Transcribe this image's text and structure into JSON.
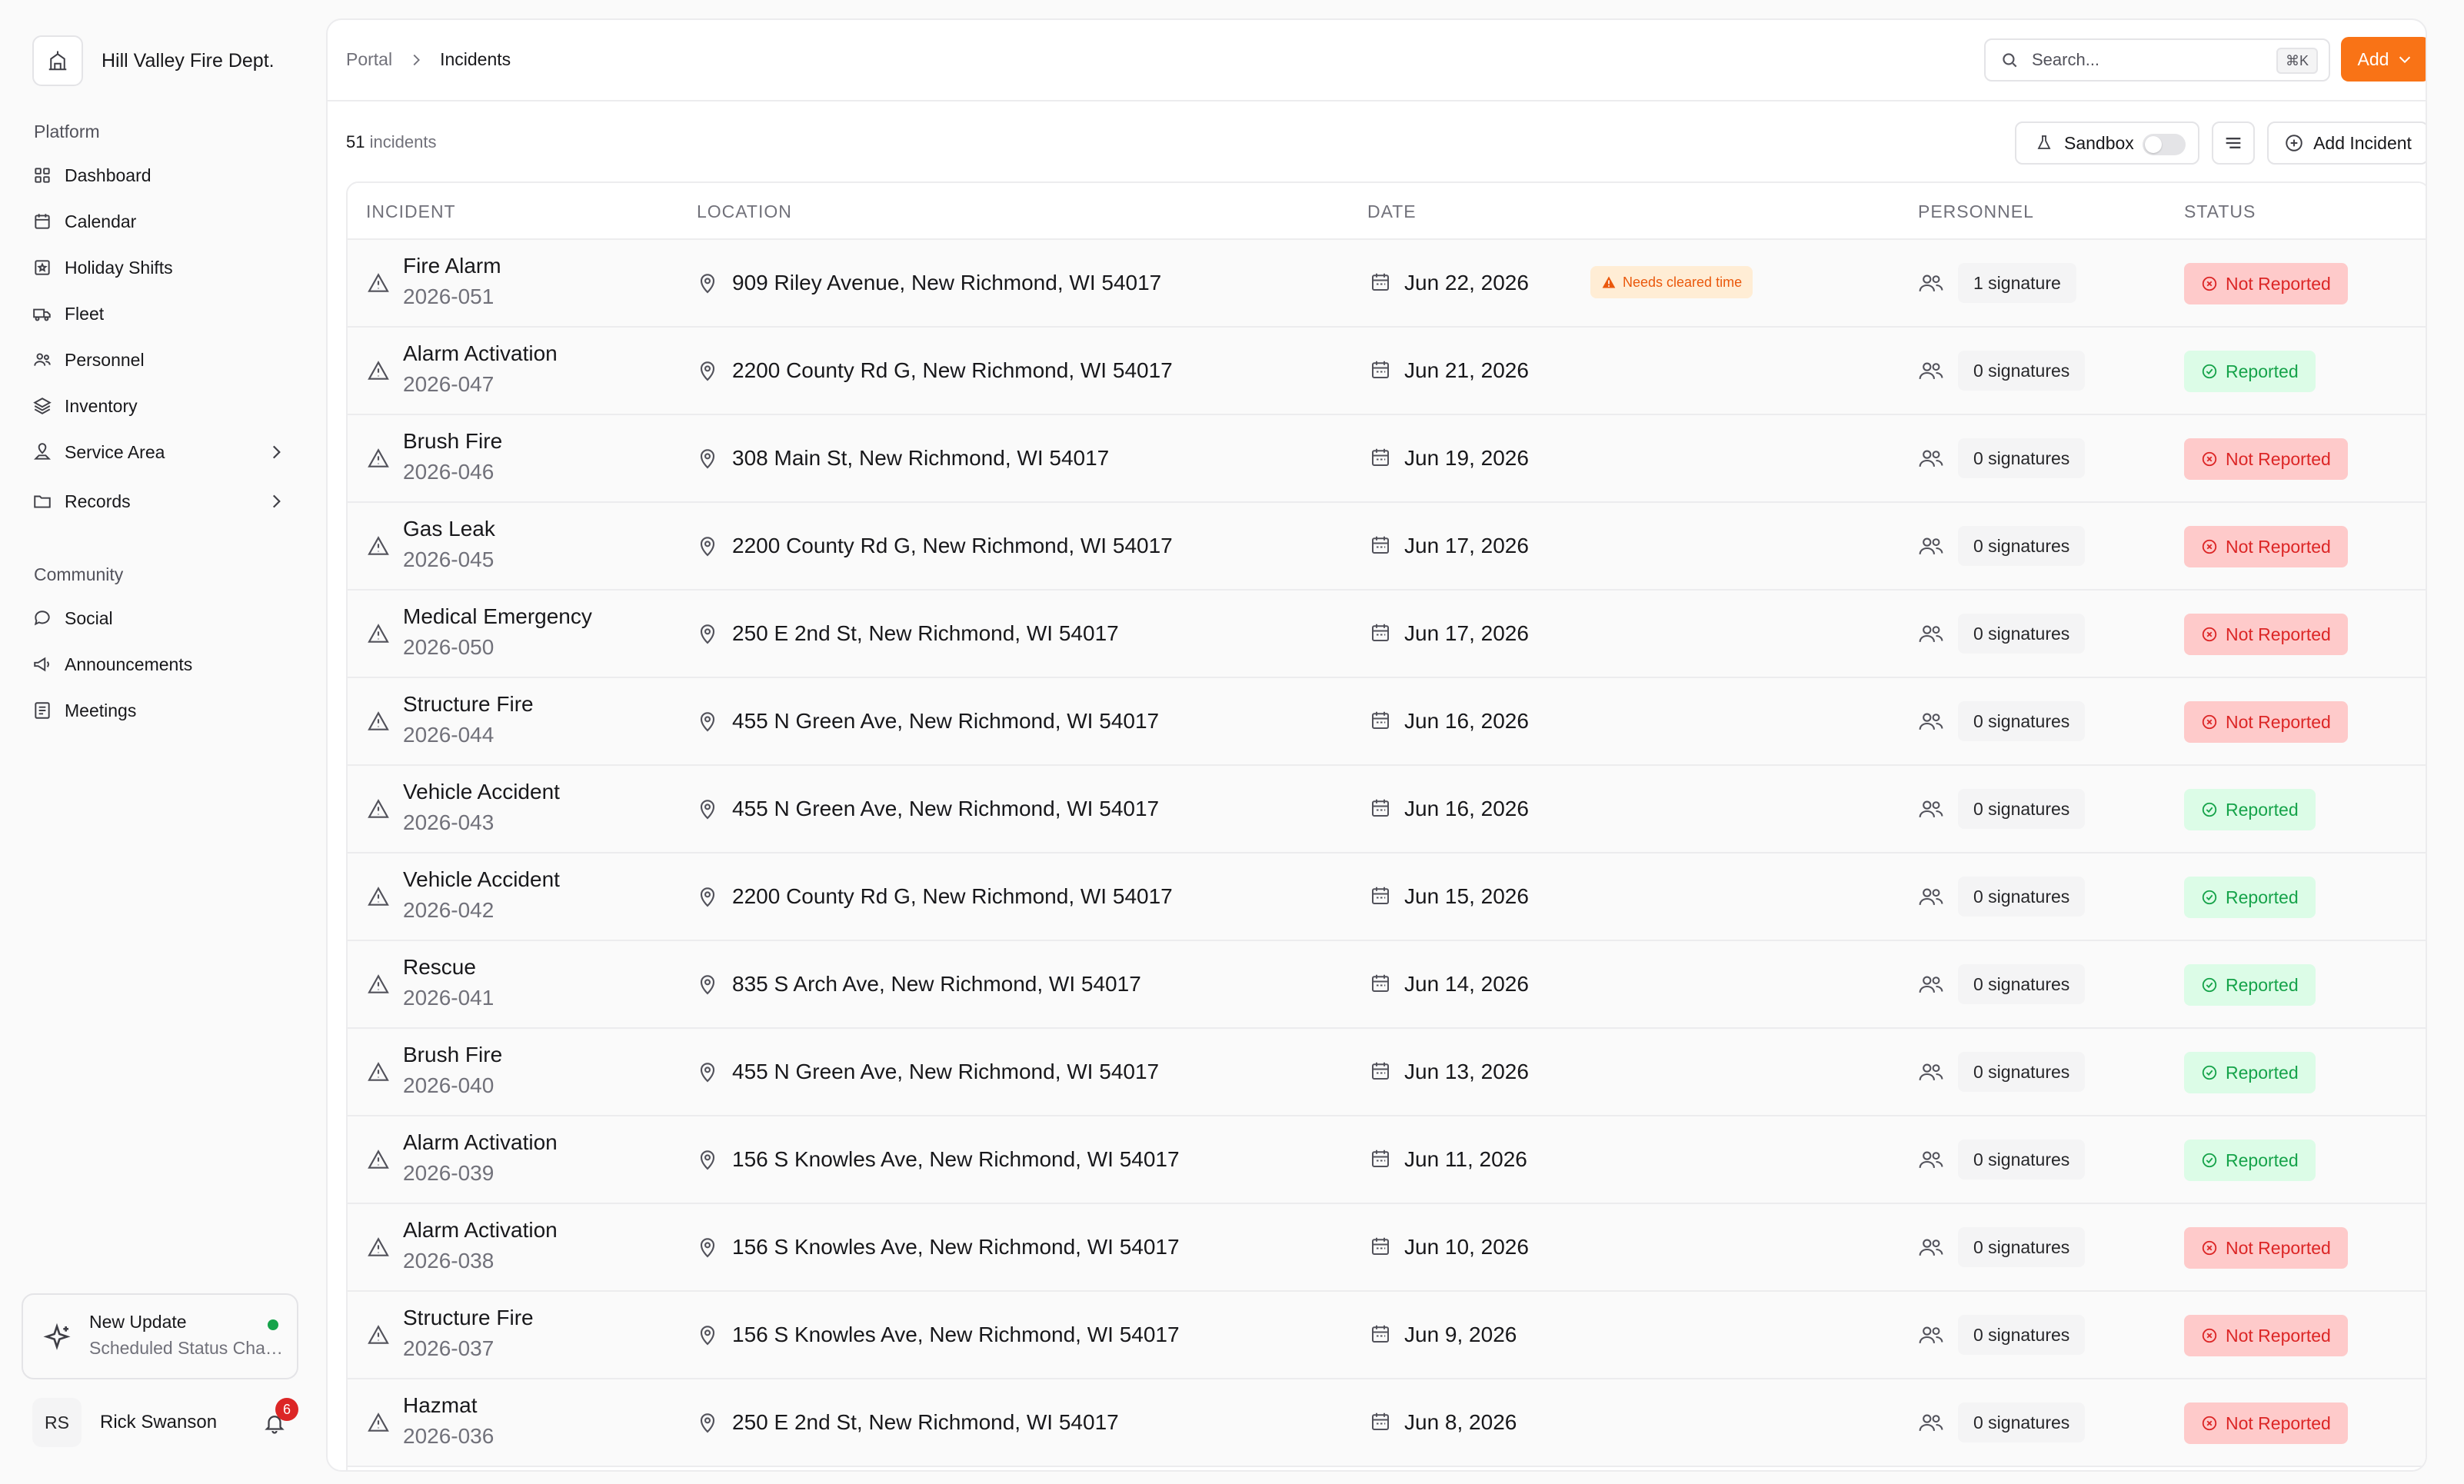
{
  "app": {
    "org_name": "Hill Valley Fire Dept.",
    "platform_label": "Platform",
    "community_label": "Community",
    "nav_platform": [
      {
        "label": "Dashboard",
        "icon": "grid-icon"
      },
      {
        "label": "Calendar",
        "icon": "calendar-icon"
      },
      {
        "label": "Holiday Shifts",
        "icon": "calendar-star-icon"
      },
      {
        "label": "Fleet",
        "icon": "truck-icon"
      },
      {
        "label": "Personnel",
        "icon": "users-icon"
      },
      {
        "label": "Inventory",
        "icon": "layers-icon"
      },
      {
        "label": "Service Area",
        "icon": "map-pin-icon"
      },
      {
        "label": "Records",
        "icon": "folder-icon"
      }
    ],
    "nav_community": [
      {
        "label": "Social",
        "icon": "chat-icon"
      },
      {
        "label": "Announcements",
        "icon": "megaphone-icon"
      },
      {
        "label": "Meetings",
        "icon": "notebook-icon"
      }
    ],
    "update": {
      "title": "New Update",
      "subtitle": "Scheduled Status Changes"
    },
    "user": {
      "initials": "RS",
      "name": "Rick Swanson",
      "notifications": "6"
    }
  },
  "header": {
    "crumb_root": "Portal",
    "crumb_current": "Incidents",
    "search_placeholder": "Search...",
    "search_shortcut": "⌘K",
    "add_label": "Add"
  },
  "toolbar": {
    "count_number": "51",
    "count_label": "incidents",
    "sandbox_label": "Sandbox",
    "add_incident_label": "Add Incident"
  },
  "table": {
    "columns": [
      "INCIDENT",
      "LOCATION",
      "DATE",
      "PERSONNEL",
      "STATUS"
    ],
    "rows": [
      {
        "name": "Fire Alarm",
        "number": "2026-051",
        "location": "909 Riley Avenue, New Richmond, WI 54017",
        "date": "Jun 22, 2026",
        "alert": "Needs cleared time",
        "signatures": "1 signature",
        "status": "Not Reported"
      },
      {
        "name": "Alarm Activation",
        "number": "2026-047",
        "location": "2200 County Rd G, New Richmond, WI 54017",
        "date": "Jun 21, 2026",
        "alert": "",
        "signatures": "0 signatures",
        "status": "Reported"
      },
      {
        "name": "Brush Fire",
        "number": "2026-046",
        "location": "308 Main St, New Richmond, WI 54017",
        "date": "Jun 19, 2026",
        "alert": "",
        "signatures": "0 signatures",
        "status": "Not Reported"
      },
      {
        "name": "Gas Leak",
        "number": "2026-045",
        "location": "2200 County Rd G, New Richmond, WI 54017",
        "date": "Jun 17, 2026",
        "alert": "",
        "signatures": "0 signatures",
        "status": "Not Reported"
      },
      {
        "name": "Medical Emergency",
        "number": "2026-050",
        "location": "250 E 2nd St, New Richmond, WI 54017",
        "date": "Jun 17, 2026",
        "alert": "",
        "signatures": "0 signatures",
        "status": "Not Reported"
      },
      {
        "name": "Structure Fire",
        "number": "2026-044",
        "location": "455 N Green Ave, New Richmond, WI 54017",
        "date": "Jun 16, 2026",
        "alert": "",
        "signatures": "0 signatures",
        "status": "Not Reported"
      },
      {
        "name": "Vehicle Accident",
        "number": "2026-043",
        "location": "455 N Green Ave, New Richmond, WI 54017",
        "date": "Jun 16, 2026",
        "alert": "",
        "signatures": "0 signatures",
        "status": "Reported"
      },
      {
        "name": "Vehicle Accident",
        "number": "2026-042",
        "location": "2200 County Rd G, New Richmond, WI 54017",
        "date": "Jun 15, 2026",
        "alert": "",
        "signatures": "0 signatures",
        "status": "Reported"
      },
      {
        "name": "Rescue",
        "number": "2026-041",
        "location": "835 S Arch Ave, New Richmond, WI 54017",
        "date": "Jun 14, 2026",
        "alert": "",
        "signatures": "0 signatures",
        "status": "Reported"
      },
      {
        "name": "Brush Fire",
        "number": "2026-040",
        "location": "455 N Green Ave, New Richmond, WI 54017",
        "date": "Jun 13, 2026",
        "alert": "",
        "signatures": "0 signatures",
        "status": "Reported"
      },
      {
        "name": "Alarm Activation",
        "number": "2026-039",
        "location": "156 S Knowles Ave, New Richmond, WI 54017",
        "date": "Jun 11, 2026",
        "alert": "",
        "signatures": "0 signatures",
        "status": "Reported"
      },
      {
        "name": "Alarm Activation",
        "number": "2026-038",
        "location": "156 S Knowles Ave, New Richmond, WI 54017",
        "date": "Jun 10, 2026",
        "alert": "",
        "signatures": "0 signatures",
        "status": "Not Reported"
      },
      {
        "name": "Structure Fire",
        "number": "2026-037",
        "location": "156 S Knowles Ave, New Richmond, WI 54017",
        "date": "Jun 9, 2026",
        "alert": "",
        "signatures": "0 signatures",
        "status": "Not Reported"
      },
      {
        "name": "Hazmat",
        "number": "2026-036",
        "location": "250 E 2nd St, New Richmond, WI 54017",
        "date": "Jun 8, 2026",
        "alert": "",
        "signatures": "0 signatures",
        "status": "Not Reported"
      }
    ]
  },
  "colors": {
    "accent": "#f97316",
    "not_reported": "#dc2626",
    "reported": "#16a34a"
  }
}
